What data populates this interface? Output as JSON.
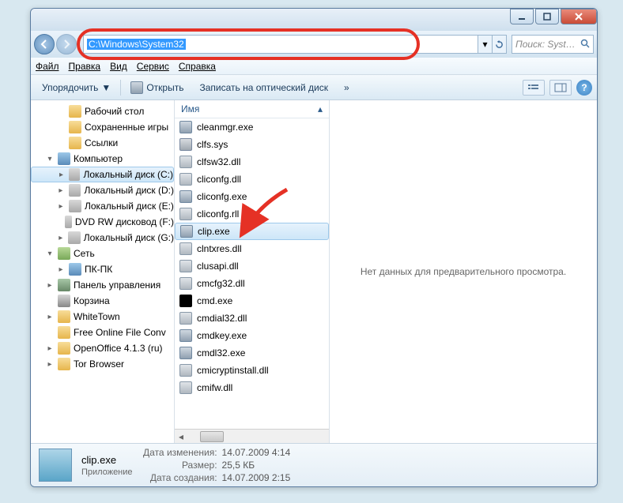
{
  "address_path": "C:\\Windows\\System32",
  "search_placeholder": "Поиск: Syst…",
  "menu": {
    "file": "Файл",
    "edit": "Правка",
    "view": "Вид",
    "tools": "Сервис",
    "help": "Справка"
  },
  "toolbar": {
    "organize": "Упорядочить",
    "open": "Открыть",
    "burn": "Записать на оптический диск",
    "chevron": "»"
  },
  "sidebar": [
    {
      "label": "Рабочий стол",
      "icon": "folder",
      "indent": 2,
      "expand": ""
    },
    {
      "label": "Сохраненные игры",
      "icon": "folder",
      "indent": 2,
      "expand": ""
    },
    {
      "label": "Ссылки",
      "icon": "folder",
      "indent": 2,
      "expand": ""
    },
    {
      "label": "Компьютер",
      "icon": "computer",
      "indent": 1,
      "expand": "▾"
    },
    {
      "label": "Локальный диск (C:)",
      "icon": "drive",
      "indent": 2,
      "expand": "▸",
      "selected": true
    },
    {
      "label": "Локальный диск (D:)",
      "icon": "drive",
      "indent": 2,
      "expand": "▸"
    },
    {
      "label": "Локальный диск (E:)",
      "icon": "drive",
      "indent": 2,
      "expand": "▸"
    },
    {
      "label": "DVD RW дисковод (F:)",
      "icon": "drive",
      "indent": 2,
      "expand": ""
    },
    {
      "label": "Локальный диск (G:)",
      "icon": "drive",
      "indent": 2,
      "expand": "▸"
    },
    {
      "label": "Сеть",
      "icon": "network",
      "indent": 1,
      "expand": "▾"
    },
    {
      "label": "ПК-ПК",
      "icon": "computer",
      "indent": 2,
      "expand": "▸"
    },
    {
      "label": "Панель управления",
      "icon": "panel",
      "indent": 1,
      "expand": "▸"
    },
    {
      "label": "Корзина",
      "icon": "recycle",
      "indent": 1,
      "expand": ""
    },
    {
      "label": "WhiteTown",
      "icon": "folder",
      "indent": 1,
      "expand": "▸"
    },
    {
      "label": "Free Online File Conv",
      "icon": "folder",
      "indent": 1,
      "expand": ""
    },
    {
      "label": "OpenOffice 4.1.3 (ru)",
      "icon": "folder",
      "indent": 1,
      "expand": "▸"
    },
    {
      "label": "Tor Browser",
      "icon": "folder",
      "indent": 1,
      "expand": "▸"
    }
  ],
  "filelist_header": "Имя",
  "files": [
    {
      "name": "cleanmgr.exe",
      "icon": "exe"
    },
    {
      "name": "clfs.sys",
      "icon": "sys"
    },
    {
      "name": "clfsw32.dll",
      "icon": "dll"
    },
    {
      "name": "cliconfg.dll",
      "icon": "dll"
    },
    {
      "name": "cliconfg.exe",
      "icon": "exe"
    },
    {
      "name": "cliconfg.rll",
      "icon": "dll"
    },
    {
      "name": "clip.exe",
      "icon": "exe",
      "selected": true
    },
    {
      "name": "clntxres.dll",
      "icon": "dll"
    },
    {
      "name": "clusapi.dll",
      "icon": "dll"
    },
    {
      "name": "cmcfg32.dll",
      "icon": "dll"
    },
    {
      "name": "cmd.exe",
      "icon": "cmd"
    },
    {
      "name": "cmdial32.dll",
      "icon": "dll"
    },
    {
      "name": "cmdkey.exe",
      "icon": "exe"
    },
    {
      "name": "cmdl32.exe",
      "icon": "exe"
    },
    {
      "name": "cmicryptinstall.dll",
      "icon": "dll"
    },
    {
      "name": "cmifw.dll",
      "icon": "dll"
    }
  ],
  "preview_text": "Нет данных для предварительного просмотра.",
  "status": {
    "filename": "clip.exe",
    "type": "Приложение",
    "modified_label": "Дата изменения:",
    "modified_value": "14.07.2009 4:14",
    "size_label": "Размер:",
    "size_value": "25,5 КБ",
    "created_label": "Дата создания:",
    "created_value": "14.07.2009 2:15"
  }
}
